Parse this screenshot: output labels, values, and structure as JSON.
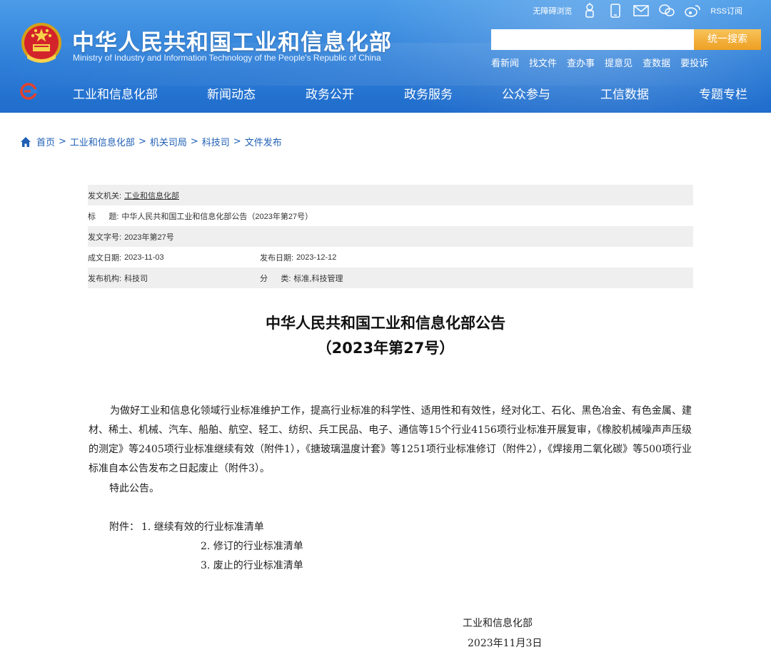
{
  "header": {
    "title": "中华人民共和国工业和信息化部",
    "subtitle": "Ministry of Industry and Information Technology of the People's Republic of China",
    "accessibility_label": "无障碍浏览",
    "rss_label": "RSS订阅",
    "top_icons": [
      "robot-icon",
      "mobile-icon",
      "mail-icon",
      "wechat-icon",
      "weibo-icon"
    ],
    "search_placeholder": "",
    "search_button": "统一搜索",
    "quick_links": [
      "看新闻",
      "找文件",
      "查办事",
      "提意见",
      "查数据",
      "要投诉"
    ],
    "nav": [
      "工业和信息化部",
      "新闻动态",
      "政务公开",
      "政务服务",
      "公众参与",
      "工信数据",
      "专题专栏"
    ],
    "colors": {
      "header_blue": "#2f7fd8",
      "search_orange": "#ee9f21",
      "link_blue": "#1f5fb5"
    }
  },
  "breadcrumb": [
    "首页",
    "工业和信息化部",
    "机关司局",
    "科技司",
    "文件发布"
  ],
  "meta": {
    "issuer_label": "发文机关:",
    "issuer": "工业和信息化部",
    "title_label": "标      题:",
    "title": "中华人民共和国工业和信息化部公告（2023年第27号）",
    "doc_no_label": "发文字号:",
    "doc_no": "2023年第27号",
    "date_made_label": "成文日期:",
    "date_made": "2023-11-03",
    "date_pub_label": "发布日期:",
    "date_pub": "2023-12-12",
    "agency_label": "发布机构:",
    "agency": "科技司",
    "category_label": "分      类:",
    "category": "标准,科技管理"
  },
  "article": {
    "title_line1": "中华人民共和国工业和信息化部公告",
    "title_line2": "（2023年第27号）",
    "paragraph": "为做好工业和信息化领域行业标准维护工作，提高行业标准的科学性、适用性和有效性，经对化工、石化、黑色冶金、有色金属、建材、稀土、机械、汽车、船舶、航空、轻工、纺织、兵工民品、电子、通信等15个行业4156项行业标准开展复审，《橡胶机械噪声声压级的测定》等2405项行业标准继续有效（附件1），《搪玻璃温度计套》等1251项行业标准修订（附件2），《焊接用二氧化碳》等500项行业标准自本公告发布之日起废止（附件3）。",
    "closing": "特此公告。",
    "attachments_label": "附件：",
    "attachments": [
      "1. 继续有效的行业标准清单",
      "2. 修订的行业标准清单",
      "3. 废止的行业标准清单"
    ],
    "signature": "工业和信息化部",
    "date": "2023年11月3日"
  }
}
